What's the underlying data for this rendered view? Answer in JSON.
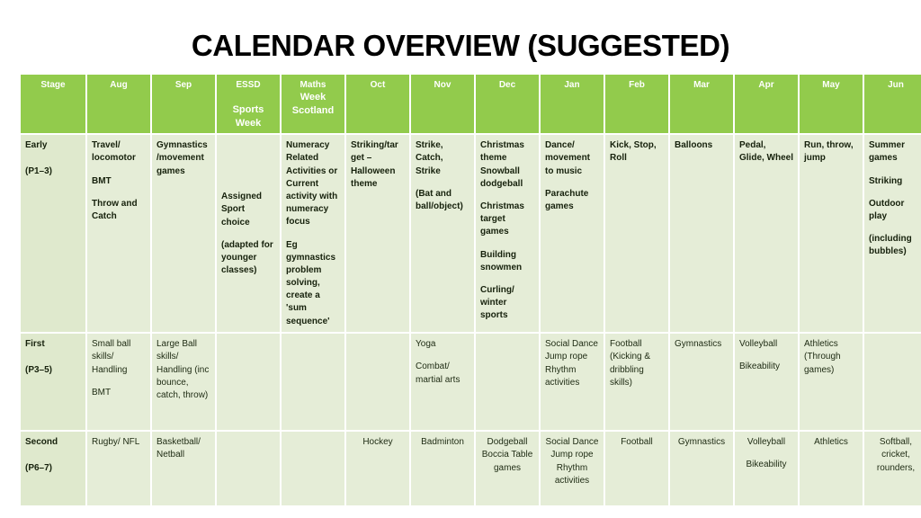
{
  "title": "CALENDAR OVERVIEW (SUGGESTED)",
  "colors": {
    "header_green": "#92cb4c",
    "stage_cell": "#dfe9cd",
    "data_cell": "#e5edd7",
    "title_text": "#000000",
    "header_text": "#ffffff",
    "body_text": "#16210c"
  },
  "table": {
    "columns": [
      {
        "label": "Stage",
        "sub": ""
      },
      {
        "label": "Aug",
        "sub": ""
      },
      {
        "label": "Sep",
        "sub": ""
      },
      {
        "label": "ESSD",
        "sub": "Sports Week"
      },
      {
        "label": "Maths",
        "sub": "Week Scotland"
      },
      {
        "label": "Oct",
        "sub": ""
      },
      {
        "label": "Nov",
        "sub": ""
      },
      {
        "label": "Dec",
        "sub": ""
      },
      {
        "label": "Jan",
        "sub": ""
      },
      {
        "label": "Feb",
        "sub": ""
      },
      {
        "label": "Mar",
        "sub": ""
      },
      {
        "label": "Apr",
        "sub": ""
      },
      {
        "label": "May",
        "sub": ""
      },
      {
        "label": "Jun",
        "sub": ""
      }
    ],
    "rows": [
      {
        "stage": "Early",
        "stage_sub": "(P1–3)",
        "aug": [
          "Travel/ locomotor",
          "BMT",
          "Throw and Catch"
        ],
        "sep": [
          "Gymnastics /movement games"
        ],
        "essd": [
          "Assigned Sport choice",
          "(adapted for younger classes)"
        ],
        "maths": [
          "Numeracy Related Activities or Current activity with numeracy focus",
          "Eg gymnastics problem solving, create a 'sum sequence'"
        ],
        "oct": [
          "Striking/tar get – Halloween theme"
        ],
        "nov": [
          "Strike, Catch, Strike",
          "(Bat and ball/object)"
        ],
        "dec": [
          "Christmas theme Snowball dodgeball",
          "Christmas target games",
          "Building snowmen",
          "Curling/ winter sports"
        ],
        "jan": [
          "Dance/ movement to music",
          "Parachute games"
        ],
        "feb": [
          "Kick, Stop, Roll"
        ],
        "mar": [
          "Balloons"
        ],
        "apr": [
          "Pedal, Glide, Wheel"
        ],
        "may": [
          "Run, throw, jump"
        ],
        "jun": [
          "Summer games",
          "Striking",
          "Outdoor play",
          "(including bubbles)"
        ]
      },
      {
        "stage": "First",
        "stage_sub": "(P3–5)",
        "aug": [
          "Small ball skills/ Handling",
          "BMT"
        ],
        "sep": [
          "Large Ball skills/ Handling (inc bounce, catch, throw)"
        ],
        "essd": [],
        "maths": [],
        "oct": [],
        "nov": [
          "Yoga",
          "Combat/ martial arts"
        ],
        "dec": [],
        "jan": [
          "Social Dance Jump rope Rhythm activities"
        ],
        "feb": [
          "Football (Kicking & dribbling skills)"
        ],
        "mar": [
          "Gymnastics"
        ],
        "apr": [
          "Volleyball",
          "Bikeability"
        ],
        "may": [
          "Athletics (Through games)"
        ],
        "jun": []
      },
      {
        "stage": "Second",
        "stage_sub": "(P6–7)",
        "aug": [
          "Rugby/ NFL"
        ],
        "sep": [
          "Basketball/ Netball"
        ],
        "essd": [],
        "maths": [],
        "oct": [
          "Hockey"
        ],
        "nov": [
          "Badminton"
        ],
        "dec": [
          "Dodgeball Boccia Table games"
        ],
        "jan": [
          "Social Dance Jump rope Rhythm activities"
        ],
        "feb": [
          "Football"
        ],
        "mar": [
          "Gymnastics"
        ],
        "apr": [
          "Volleyball",
          "Bikeability"
        ],
        "may": [
          "Athletics"
        ],
        "jun": [
          "Softball, cricket, rounders,"
        ]
      }
    ]
  }
}
